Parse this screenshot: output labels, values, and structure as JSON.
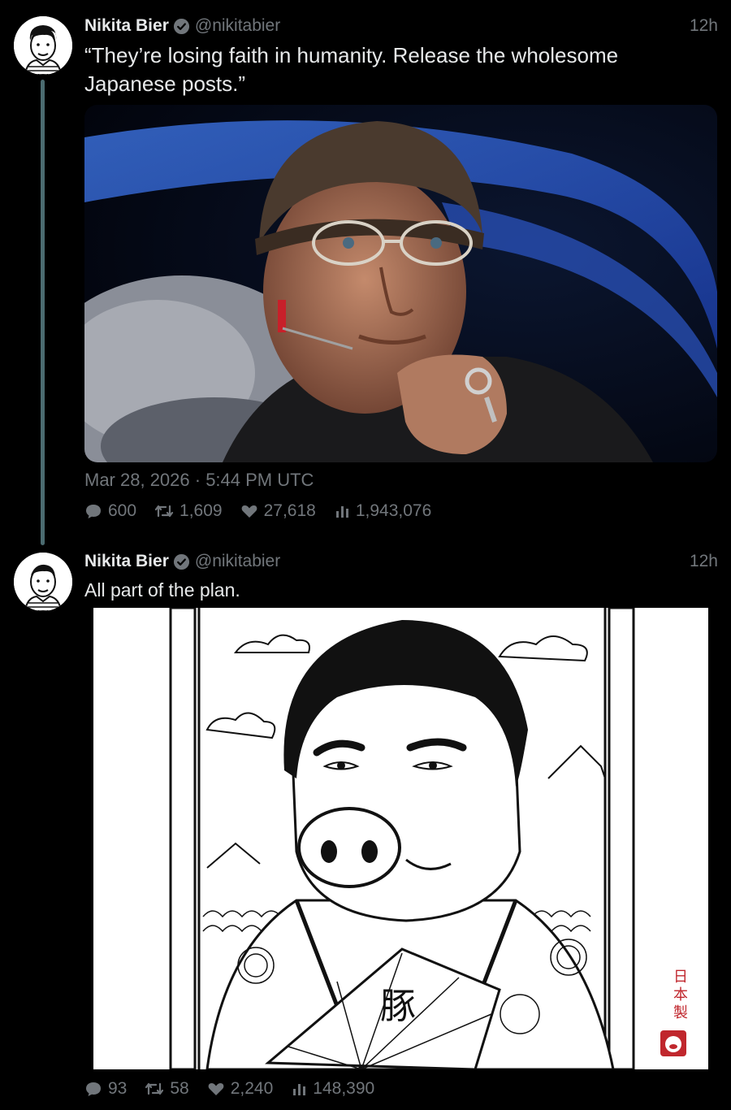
{
  "posts": [
    {
      "author": "Nikita Bier",
      "handle": "@nikitabier",
      "time": "12h",
      "text": "“They’re losing faith in humanity. Release the wholesome Japanese posts.”",
      "timestamp": "Mar 28, 2026 · 5:44 PM UTC",
      "metrics": {
        "replies": "600",
        "reposts": "1,609",
        "likes": "27,618",
        "views": "1,943,076"
      },
      "media": "photo-man-with-glasses-in-cap-space-background"
    },
    {
      "author": "Nikita Bier",
      "handle": "@nikitabier",
      "time": "12h",
      "text": "All part of the plan.",
      "metrics": {
        "replies": "93",
        "reposts": "58",
        "likes": "2,240",
        "views": "148,390"
      },
      "media": "illustration-pig-man-japanese-woodblock",
      "media_text": {
        "fan_kanji": "豚",
        "vertical_label": "日本製"
      }
    }
  ],
  "icons": [
    "verified-badge-icon",
    "reply-icon",
    "repost-icon",
    "like-icon",
    "views-icon"
  ],
  "colors": {
    "background": "#000000",
    "text": "#e7e9ea",
    "muted": "#71767b",
    "verified": "#71767b",
    "thread_line": "#4b6b70",
    "stamp_red": "#c0272d"
  }
}
